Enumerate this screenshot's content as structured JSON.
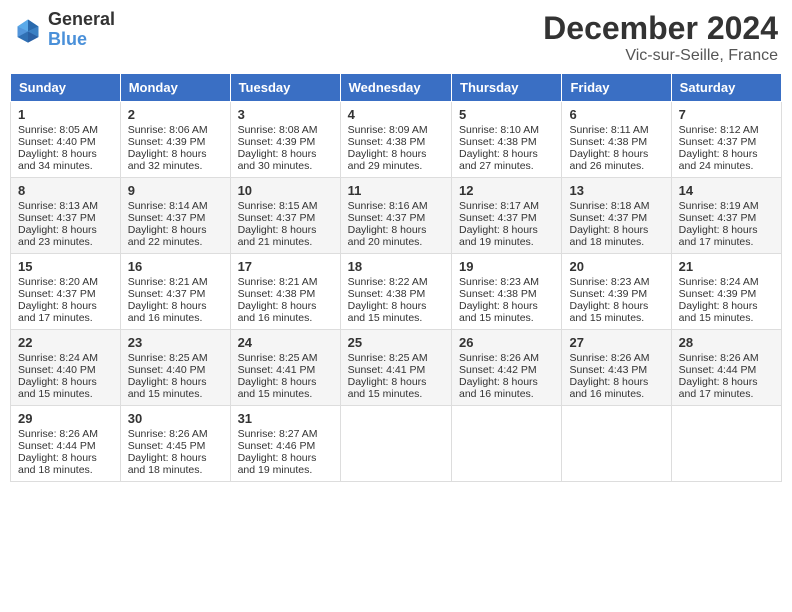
{
  "header": {
    "logo_general": "General",
    "logo_blue": "Blue",
    "month_title": "December 2024",
    "location": "Vic-sur-Seille, France"
  },
  "days_of_week": [
    "Sunday",
    "Monday",
    "Tuesday",
    "Wednesday",
    "Thursday",
    "Friday",
    "Saturday"
  ],
  "weeks": [
    [
      {
        "day": "1",
        "sunrise": "8:05 AM",
        "sunset": "4:40 PM",
        "daylight": "8 hours and 34 minutes."
      },
      {
        "day": "2",
        "sunrise": "8:06 AM",
        "sunset": "4:39 PM",
        "daylight": "8 hours and 32 minutes."
      },
      {
        "day": "3",
        "sunrise": "8:08 AM",
        "sunset": "4:39 PM",
        "daylight": "8 hours and 30 minutes."
      },
      {
        "day": "4",
        "sunrise": "8:09 AM",
        "sunset": "4:38 PM",
        "daylight": "8 hours and 29 minutes."
      },
      {
        "day": "5",
        "sunrise": "8:10 AM",
        "sunset": "4:38 PM",
        "daylight": "8 hours and 27 minutes."
      },
      {
        "day": "6",
        "sunrise": "8:11 AM",
        "sunset": "4:38 PM",
        "daylight": "8 hours and 26 minutes."
      },
      {
        "day": "7",
        "sunrise": "8:12 AM",
        "sunset": "4:37 PM",
        "daylight": "8 hours and 24 minutes."
      }
    ],
    [
      {
        "day": "8",
        "sunrise": "8:13 AM",
        "sunset": "4:37 PM",
        "daylight": "8 hours and 23 minutes."
      },
      {
        "day": "9",
        "sunrise": "8:14 AM",
        "sunset": "4:37 PM",
        "daylight": "8 hours and 22 minutes."
      },
      {
        "day": "10",
        "sunrise": "8:15 AM",
        "sunset": "4:37 PM",
        "daylight": "8 hours and 21 minutes."
      },
      {
        "day": "11",
        "sunrise": "8:16 AM",
        "sunset": "4:37 PM",
        "daylight": "8 hours and 20 minutes."
      },
      {
        "day": "12",
        "sunrise": "8:17 AM",
        "sunset": "4:37 PM",
        "daylight": "8 hours and 19 minutes."
      },
      {
        "day": "13",
        "sunrise": "8:18 AM",
        "sunset": "4:37 PM",
        "daylight": "8 hours and 18 minutes."
      },
      {
        "day": "14",
        "sunrise": "8:19 AM",
        "sunset": "4:37 PM",
        "daylight": "8 hours and 17 minutes."
      }
    ],
    [
      {
        "day": "15",
        "sunrise": "8:20 AM",
        "sunset": "4:37 PM",
        "daylight": "8 hours and 17 minutes."
      },
      {
        "day": "16",
        "sunrise": "8:21 AM",
        "sunset": "4:37 PM",
        "daylight": "8 hours and 16 minutes."
      },
      {
        "day": "17",
        "sunrise": "8:21 AM",
        "sunset": "4:38 PM",
        "daylight": "8 hours and 16 minutes."
      },
      {
        "day": "18",
        "sunrise": "8:22 AM",
        "sunset": "4:38 PM",
        "daylight": "8 hours and 15 minutes."
      },
      {
        "day": "19",
        "sunrise": "8:23 AM",
        "sunset": "4:38 PM",
        "daylight": "8 hours and 15 minutes."
      },
      {
        "day": "20",
        "sunrise": "8:23 AM",
        "sunset": "4:39 PM",
        "daylight": "8 hours and 15 minutes."
      },
      {
        "day": "21",
        "sunrise": "8:24 AM",
        "sunset": "4:39 PM",
        "daylight": "8 hours and 15 minutes."
      }
    ],
    [
      {
        "day": "22",
        "sunrise": "8:24 AM",
        "sunset": "4:40 PM",
        "daylight": "8 hours and 15 minutes."
      },
      {
        "day": "23",
        "sunrise": "8:25 AM",
        "sunset": "4:40 PM",
        "daylight": "8 hours and 15 minutes."
      },
      {
        "day": "24",
        "sunrise": "8:25 AM",
        "sunset": "4:41 PM",
        "daylight": "8 hours and 15 minutes."
      },
      {
        "day": "25",
        "sunrise": "8:25 AM",
        "sunset": "4:41 PM",
        "daylight": "8 hours and 15 minutes."
      },
      {
        "day": "26",
        "sunrise": "8:26 AM",
        "sunset": "4:42 PM",
        "daylight": "8 hours and 16 minutes."
      },
      {
        "day": "27",
        "sunrise": "8:26 AM",
        "sunset": "4:43 PM",
        "daylight": "8 hours and 16 minutes."
      },
      {
        "day": "28",
        "sunrise": "8:26 AM",
        "sunset": "4:44 PM",
        "daylight": "8 hours and 17 minutes."
      }
    ],
    [
      {
        "day": "29",
        "sunrise": "8:26 AM",
        "sunset": "4:44 PM",
        "daylight": "8 hours and 18 minutes."
      },
      {
        "day": "30",
        "sunrise": "8:26 AM",
        "sunset": "4:45 PM",
        "daylight": "8 hours and 18 minutes."
      },
      {
        "day": "31",
        "sunrise": "8:27 AM",
        "sunset": "4:46 PM",
        "daylight": "8 hours and 19 minutes."
      },
      null,
      null,
      null,
      null
    ]
  ]
}
